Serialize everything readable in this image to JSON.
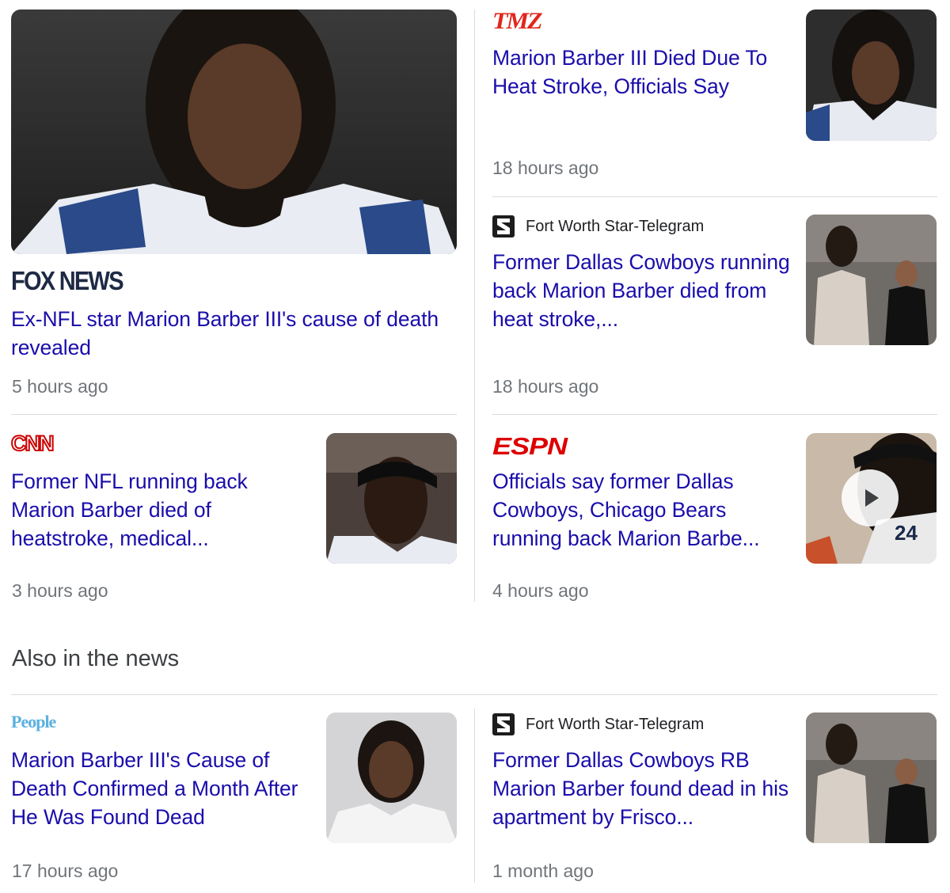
{
  "stories": [
    {
      "source": "FOX NEWS",
      "headline": "Ex-NFL star Marion Barber III's cause of death revealed",
      "time": "5 hours ago",
      "logo_color": "#1e2a44"
    },
    {
      "source": "TMZ",
      "headline": "Marion Barber III Died Due To Heat Stroke, Officials Say",
      "time": "18 hours ago",
      "logo_color": "#e1261c"
    },
    {
      "source": "Fort Worth Star-Telegram",
      "headline": "Former Dallas Cowboys running back Marion Barber died from heat stroke,...",
      "time": "18 hours ago"
    },
    {
      "source": "CNN",
      "headline": "Former NFL running back Marion Barber died of heatstroke, medical...",
      "time": "3 hours ago",
      "logo_color": "#cc0000"
    },
    {
      "source": "ESPN",
      "headline": "Officials say former Dallas Cowboys, Chicago Bears running back Marion Barbe...",
      "time": "4 hours ago",
      "logo_color": "#dd0000"
    }
  ],
  "also_title": "Also in the news",
  "also": [
    {
      "source": "People",
      "headline": "Marion Barber III's Cause of Death Confirmed a Month After He Was Found Dead",
      "time": "17 hours ago",
      "logo_color": "#5bb0e0"
    },
    {
      "source": "Fort Worth Star-Telegram",
      "headline": "Former Dallas Cowboys RB Marion Barber found dead in his apartment by Frisco...",
      "time": "1 month ago"
    }
  ],
  "icons": {
    "video": "play-icon"
  },
  "colors": {
    "link": "#1a0dab",
    "meta": "#70757a",
    "divider": "#dadce0"
  }
}
